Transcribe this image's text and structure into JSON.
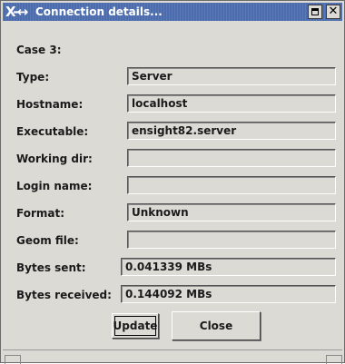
{
  "window": {
    "title": "Connection details...",
    "menu_glyph": "X-↔"
  },
  "case_label": "Case 3:",
  "fields": [
    {
      "label": "Type:",
      "value": "Server"
    },
    {
      "label": "Hostname:",
      "value": "localhost"
    },
    {
      "label": "Executable:",
      "value": "ensight82.server"
    },
    {
      "label": "Working dir:",
      "value": ""
    },
    {
      "label": "Login name:",
      "value": ""
    },
    {
      "label": "Format:",
      "value": "Unknown"
    },
    {
      "label": "Geom file:",
      "value": ""
    },
    {
      "label": "Bytes sent:",
      "value": "0.041339 MBs"
    },
    {
      "label": "Bytes received:",
      "value": "0.144092 MBs"
    }
  ],
  "buttons": {
    "update_label": "Update",
    "close_label": "Close"
  },
  "icons": {
    "maximize": "maximize-icon",
    "close": "close-icon",
    "window_menu": "window-menu-icon"
  },
  "colors": {
    "titlebar": "#4c6cae",
    "background": "#dcdad5"
  }
}
